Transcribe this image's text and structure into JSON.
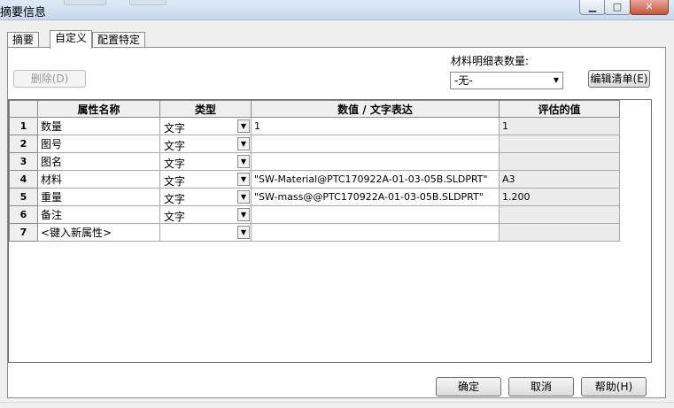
{
  "window": {
    "title": "摘要信息",
    "minimize_icon": "minimize-icon",
    "maximize_icon": "maximize-icon",
    "close_icon": "close-icon"
  },
  "tabs": [
    {
      "label": "摘要",
      "active": false
    },
    {
      "label": "自定义",
      "active": true
    },
    {
      "label": "配置特定",
      "active": false
    }
  ],
  "toolbar": {
    "delete_label": "删除(D)",
    "bom_quantity_label": "材料明细表数量:",
    "bom_quantity_value": "-无-",
    "edit_list_label": "编辑清单(E)"
  },
  "grid": {
    "headers": [
      "",
      "属性名称",
      "类型",
      "数值 / 文字表达",
      "评估的值"
    ],
    "rows": [
      {
        "num": "1",
        "name": "数量",
        "type": "文字",
        "value": "1",
        "evaluated": "1"
      },
      {
        "num": "2",
        "name": "图号",
        "type": "文字",
        "value": "",
        "evaluated": ""
      },
      {
        "num": "3",
        "name": "图名",
        "type": "文字",
        "value": "",
        "evaluated": ""
      },
      {
        "num": "4",
        "name": "材料",
        "type": "文字",
        "value": "\"SW-Material@PTC170922A-01-03-05B.SLDPRT\"",
        "evaluated": "A3"
      },
      {
        "num": "5",
        "name": "重量",
        "type": "文字",
        "value": "\"SW-mass@@PTC170922A-01-03-05B.SLDPRT\"",
        "evaluated": "1.200"
      },
      {
        "num": "6",
        "name": "备注",
        "type": "文字",
        "value": "",
        "evaluated": ""
      },
      {
        "num": "7",
        "name": "<键入新属性>",
        "type": "",
        "value": "",
        "evaluated": ""
      }
    ]
  },
  "footer": {
    "ok_label": "确定",
    "cancel_label": "取消",
    "help_label": "帮助(H)"
  },
  "colors": {
    "title_bar": "#c7d9ef",
    "dialog_bg": "#f0f0f0",
    "header_bg": "#efefef",
    "evaluated_bg": "#ececec"
  }
}
